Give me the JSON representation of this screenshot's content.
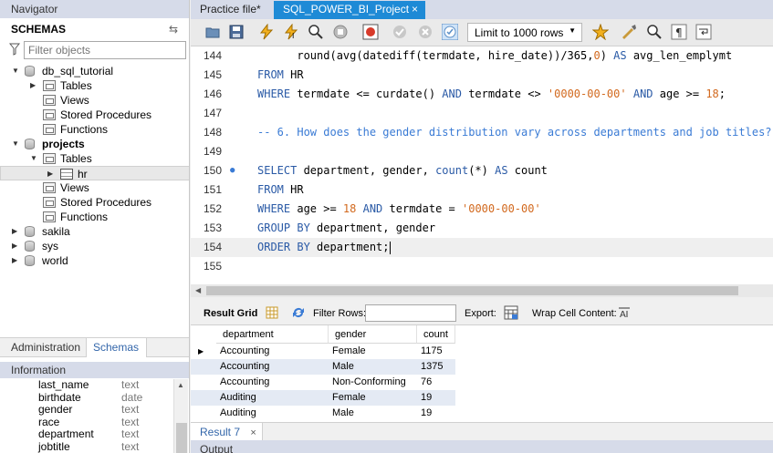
{
  "navigator": {
    "title": "Navigator",
    "schemas_label": "SCHEMAS",
    "filter_placeholder": "Filter objects",
    "tree": [
      {
        "label": "db_sql_tutorial",
        "level": 0,
        "expanded": true,
        "bold": false,
        "icon": "database-icon"
      },
      {
        "label": "Tables",
        "level": 1,
        "expanded": false,
        "bold": false,
        "icon": "folder-icon"
      },
      {
        "label": "Views",
        "level": 1,
        "bold": false,
        "icon": "folder-icon"
      },
      {
        "label": "Stored Procedures",
        "level": 1,
        "bold": false,
        "icon": "folder-icon"
      },
      {
        "label": "Functions",
        "level": 1,
        "bold": false,
        "icon": "folder-icon"
      },
      {
        "label": "projects",
        "level": 0,
        "expanded": true,
        "bold": true,
        "icon": "database-icon"
      },
      {
        "label": "Tables",
        "level": 1,
        "expanded": true,
        "bold": false,
        "icon": "folder-icon"
      },
      {
        "label": "hr",
        "level": 2,
        "expanded": false,
        "bold": false,
        "icon": "table-icon",
        "selected": true
      },
      {
        "label": "Views",
        "level": 1,
        "bold": false,
        "icon": "folder-icon"
      },
      {
        "label": "Stored Procedures",
        "level": 1,
        "bold": false,
        "icon": "folder-icon"
      },
      {
        "label": "Functions",
        "level": 1,
        "bold": false,
        "icon": "folder-icon"
      },
      {
        "label": "sakila",
        "level": 0,
        "expanded": false,
        "bold": false,
        "icon": "database-icon"
      },
      {
        "label": "sys",
        "level": 0,
        "expanded": false,
        "bold": false,
        "icon": "database-icon"
      },
      {
        "label": "world",
        "level": 0,
        "expanded": false,
        "bold": false,
        "icon": "database-icon"
      }
    ],
    "tabs": {
      "administration": "Administration",
      "schemas": "Schemas"
    },
    "information": {
      "title": "Information",
      "columns": [
        {
          "name": "last_name",
          "type": "text"
        },
        {
          "name": "birthdate",
          "type": "date"
        },
        {
          "name": "gender",
          "type": "text"
        },
        {
          "name": "race",
          "type": "text"
        },
        {
          "name": "department",
          "type": "text"
        },
        {
          "name": "jobtitle",
          "type": "text"
        }
      ]
    }
  },
  "file_tabs": {
    "practice": "Practice file*",
    "active": "SQL_POWER_BI_Project",
    "close": "×"
  },
  "toolbar": {
    "limit_value": "Limit to 1000 rows"
  },
  "editor": {
    "lines": [
      {
        "n": "144",
        "html": "      round(avg(datediff(termdate, hire_date))/365,<span class=\"num\">0</span>) <span class=\"kw\">AS</span> avg_len_emplymt"
      },
      {
        "n": "145",
        "html": "<span class=\"kw\">FROM</span> HR"
      },
      {
        "n": "146",
        "html": "<span class=\"kw\">WHERE</span> termdate &lt;= curdate() <span class=\"kw\">AND</span> termdate &lt;&gt; <span class=\"str\">'0000-00-00'</span> <span class=\"kw\">AND</span> age &gt;= <span class=\"num\">18</span>;"
      },
      {
        "n": "147",
        "html": ""
      },
      {
        "n": "148",
        "html": "<span class=\"cm\">-- 6. How does the gender distribution vary across departments and job titles?</span>"
      },
      {
        "n": "149",
        "html": ""
      },
      {
        "n": "150",
        "html": "<span class=\"kw\">SELECT</span> department, gender, <span class=\"kw\">count</span>(*) <span class=\"kw\">AS</span> count",
        "dot": true
      },
      {
        "n": "151",
        "html": "<span class=\"kw\">FROM</span> HR"
      },
      {
        "n": "152",
        "html": "<span class=\"kw\">WHERE</span> age &gt;= <span class=\"num\">18</span> <span class=\"kw\">AND</span> termdate = <span class=\"str\">'0000-00-00'</span>"
      },
      {
        "n": "153",
        "html": "<span class=\"kw\">GROUP BY</span> department, gender"
      },
      {
        "n": "154",
        "html": "<span class=\"kw\">ORDER BY</span> department;<span class=\"cursor\"></span>",
        "current": true
      },
      {
        "n": "155",
        "html": ""
      }
    ]
  },
  "result_toolbar": {
    "grid_label": "Result Grid",
    "filter_label": "Filter Rows:",
    "export_label": "Export:",
    "wrap_label": "Wrap Cell Content:"
  },
  "grid": {
    "columns": [
      "department",
      "gender",
      "count"
    ],
    "rows": [
      [
        "Accounting",
        "Female",
        "1175"
      ],
      [
        "Accounting",
        "Male",
        "1375"
      ],
      [
        "Accounting",
        "Non-Conforming",
        "76"
      ],
      [
        "Auditing",
        "Female",
        "19"
      ],
      [
        "Auditing",
        "Male",
        "19"
      ]
    ]
  },
  "result_tabs": {
    "result": "Result 7",
    "close": "×"
  },
  "output": {
    "label": "Output"
  }
}
